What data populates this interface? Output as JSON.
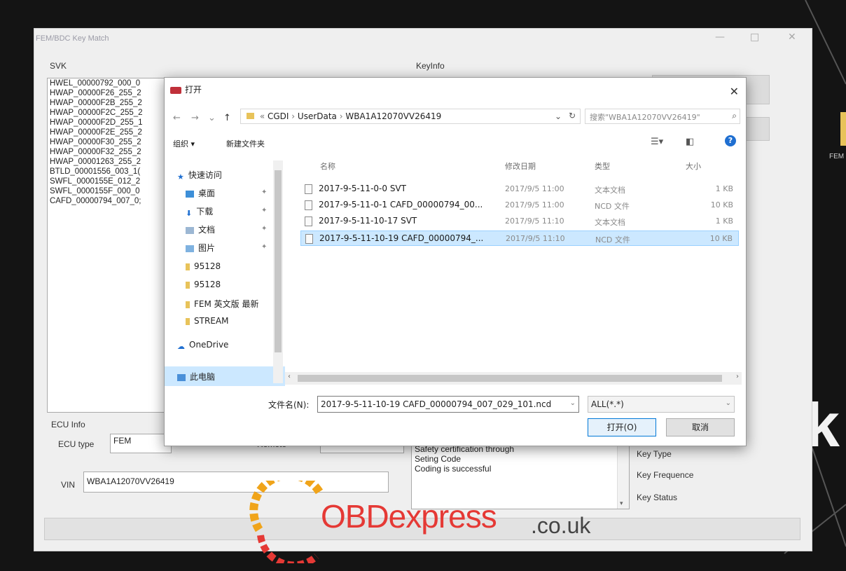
{
  "side": {
    "fem_text": "FEM",
    "big_text": "k"
  },
  "app": {
    "title": "FEM/BDC Key Match",
    "svk_label": "SVK",
    "svk_items": [
      "HWEL_00000792_000_0",
      "HWAP_00000F26_255_2",
      "HWAP_00000F2B_255_2",
      "HWAP_00000F2C_255_2",
      "HWAP_00000F2D_255_1",
      "HWAP_00000F2E_255_2",
      "HWAP_00000F30_255_2",
      "HWAP_00000F32_255_2",
      "HWAP_00001263_255_2",
      "BTLD_00001556_003_1(",
      "SWFL_0000155E_012_2",
      "SWFL_0000155F_000_0",
      "CAFD_00000794_007_0;"
    ],
    "keyinfo_label": "KeyInfo",
    "ecu_info_label": "ECU Info",
    "ecu_type_label": "ECU type",
    "ecu_type_value": "FEM",
    "remote_label": "Remote",
    "vin_label": "VIN",
    "vin_value": "WBA1A12070VV26419",
    "log_lines": [
      "Safety certification through",
      "Seting Code",
      "Coding is successful"
    ],
    "key_type_label": "Key Type",
    "key_frequence_label": "Key Frequence",
    "key_status_label": "Key Status"
  },
  "dialog": {
    "title": "打开",
    "address": [
      "CGDI",
      "UserData",
      "WBA1A12070VV26419"
    ],
    "search_placeholder": "搜索\"WBA1A12070VV26419\"",
    "toolbar": {
      "organize": "组织 ▾",
      "new_folder": "新建文件夹"
    },
    "nav_items": [
      {
        "label": "快速访问",
        "icon": "star-icon"
      },
      {
        "label": "桌面",
        "icon": "desktop-icon"
      },
      {
        "label": "下载",
        "icon": "download-icon"
      },
      {
        "label": "文档",
        "icon": "document-icon"
      },
      {
        "label": "图片",
        "icon": "picture-icon"
      },
      {
        "label": "95128",
        "icon": "folder-icon"
      },
      {
        "label": "95128",
        "icon": "folder-icon"
      },
      {
        "label": "FEM 英文版 最新",
        "icon": "folder-icon"
      },
      {
        "label": "STREAM",
        "icon": "folder-icon"
      },
      {
        "label": "OneDrive",
        "icon": "cloud-icon"
      },
      {
        "label": "此电脑",
        "icon": "computer-icon"
      }
    ],
    "columns": {
      "name": "名称",
      "date": "修改日期",
      "type": "类型",
      "size": "大小"
    },
    "files": [
      {
        "name": "2017-9-5-11-0-0 SVT",
        "date": "2017/9/5 11:00",
        "type": "文本文档",
        "size": "1 KB"
      },
      {
        "name": "2017-9-5-11-0-1 CAFD_00000794_00...",
        "date": "2017/9/5 11:00",
        "type": "NCD 文件",
        "size": "10 KB"
      },
      {
        "name": "2017-9-5-11-10-17 SVT",
        "date": "2017/9/5 11:10",
        "type": "文本文档",
        "size": "1 KB"
      },
      {
        "name": "2017-9-5-11-10-19 CAFD_00000794_...",
        "date": "2017/9/5 11:10",
        "type": "NCD 文件",
        "size": "10 KB"
      }
    ],
    "filename_label": "文件名(N):",
    "filename_value": "2017-9-5-11-10-19 CAFD_00000794_007_029_101.ncd",
    "filetype_value": "ALL(*.*)",
    "open_button": "打开(O)",
    "cancel_button": "取消"
  },
  "watermark": {
    "main": "OBDexpress",
    "suffix": ".co.uk"
  },
  "colors": {
    "accent": "#0078d7",
    "selection": "#cce8ff",
    "watermark": "#e53935"
  }
}
